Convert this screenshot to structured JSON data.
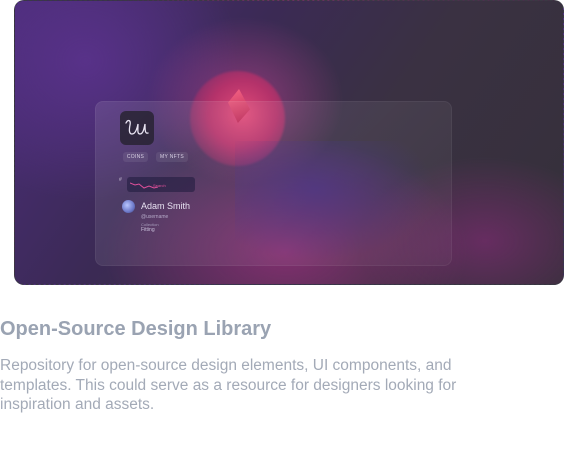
{
  "preview": {
    "tabs": [
      {
        "label": "COINS"
      },
      {
        "label": "MY NFTS"
      }
    ],
    "trend_marker": "#",
    "trend_label": "Search",
    "user": {
      "name": "Adam Smith",
      "handle": "@username",
      "meta_label": "Collection",
      "meta_value": "Fitting"
    },
    "colors": {
      "accent_pink": "#e0509a",
      "orb": "#e04a78",
      "background_purple": "#4b2d7a"
    }
  },
  "project": {
    "title": "Open-Source Design Library",
    "description": "Repository for open-source design elements, UI components, and templates. This could serve as a resource for designers looking for inspiration and assets."
  }
}
